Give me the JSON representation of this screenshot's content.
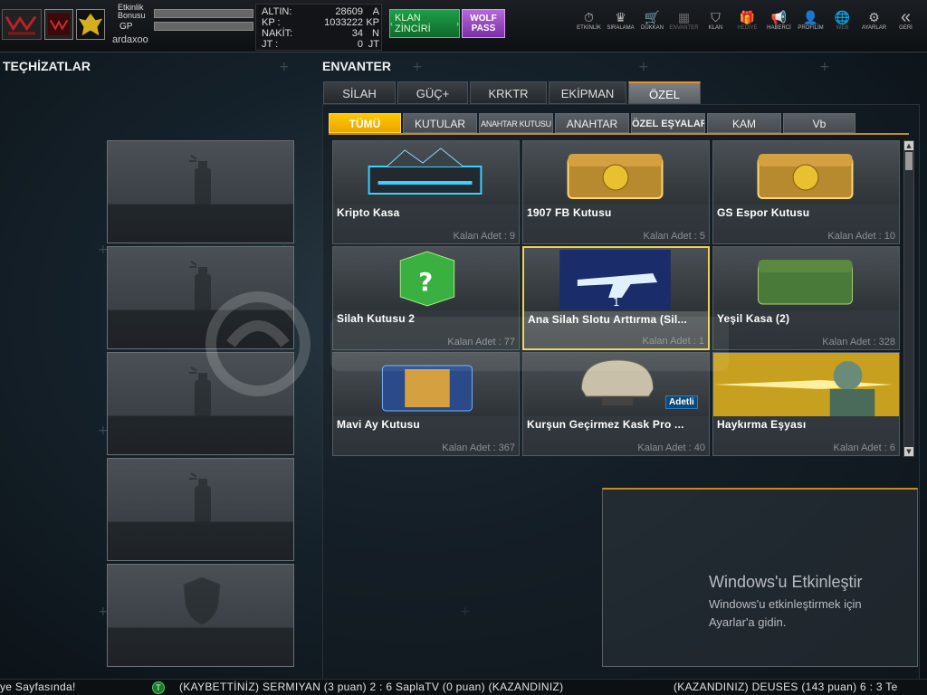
{
  "header": {
    "bars": {
      "etkinlik_label": "Etkinlik\nBonusu",
      "gp_label": "GP"
    },
    "username": "ardaxoo",
    "currency": [
      {
        "label": "ALTIN:",
        "value": "28609",
        "unit": "A"
      },
      {
        "label": "KP  :",
        "value": "1033222",
        "unit": "KP"
      },
      {
        "label": "NAKİT:",
        "value": "34",
        "unit": "N"
      },
      {
        "label": "JT  :",
        "value": "0",
        "unit": "JT"
      }
    ],
    "klan_button": "KLAN ZİNCİRİ",
    "wolf_button": "WOLF\nPASS",
    "nav": [
      {
        "icon": "stopwatch-icon",
        "glyph": "⏱",
        "label": "ETKİNLİK",
        "enabled": true
      },
      {
        "icon": "rank-icon",
        "glyph": "♛",
        "label": "SIRALAMA",
        "enabled": true
      },
      {
        "icon": "cart-icon",
        "glyph": "🛒",
        "label": "DÜKKAN",
        "enabled": true
      },
      {
        "icon": "inventory-icon",
        "glyph": "▦",
        "label": "ENVANTER",
        "enabled": false
      },
      {
        "icon": "clan-icon",
        "glyph": "⛉",
        "label": "KLAN",
        "enabled": true
      },
      {
        "icon": "gift-icon",
        "glyph": "🎁",
        "label": "HEDİYE",
        "enabled": false
      },
      {
        "icon": "megaphone-icon",
        "glyph": "📢",
        "label": "HABERCİ",
        "enabled": true
      },
      {
        "icon": "profile-icon",
        "glyph": "👤",
        "label": "PROFİLİM",
        "enabled": true
      },
      {
        "icon": "globe-icon",
        "glyph": "🌐",
        "label": "WEB",
        "enabled": false
      },
      {
        "icon": "gear-icon",
        "glyph": "⚙",
        "label": "AYARLAR",
        "enabled": true
      },
      {
        "icon": "back-icon",
        "glyph": "«",
        "label": "GERİ",
        "enabled": true
      }
    ]
  },
  "left_panel": {
    "title": "TEÇHİZATLAR",
    "slots": [
      {
        "type": "spray"
      },
      {
        "type": "spray"
      },
      {
        "type": "spray"
      },
      {
        "type": "spray"
      },
      {
        "type": "shield"
      }
    ]
  },
  "inventory": {
    "title": "ENVANTER",
    "tabs": [
      {
        "label": "SİLAH",
        "active": false
      },
      {
        "label": "GÜÇ+",
        "active": false
      },
      {
        "label": "KRKTR",
        "active": false
      },
      {
        "label": "EKİPMAN",
        "active": false
      },
      {
        "label": "ÖZEL",
        "active": true
      }
    ],
    "subtabs": [
      {
        "label": "TÜMÜ",
        "active": true
      },
      {
        "label": "KUTULAR",
        "active": false
      },
      {
        "label": "ANAHTAR KUTUSU",
        "active": false
      },
      {
        "label": "ANAHTAR",
        "active": false
      },
      {
        "label": "ÖZEL EŞYALAR",
        "active": false
      },
      {
        "label": "KAM",
        "active": false
      },
      {
        "label": "Vb",
        "active": false
      }
    ],
    "count_prefix": "Kalan Adet : ",
    "items": [
      {
        "name": "Kripto Kasa",
        "count": "9",
        "art": "crypto"
      },
      {
        "name": "1907 FB Kutusu",
        "count": "5",
        "art": "goldchest"
      },
      {
        "name": "GS Espor Kutusu",
        "count": "10",
        "art": "goldchest"
      },
      {
        "name": "Silah Kutusu 2",
        "count": "77",
        "art": "greencube"
      },
      {
        "name": "Ana Silah Slotu Arttırma (Sil...",
        "count": "1",
        "art": "gun",
        "selected": true
      },
      {
        "name": "Yeşil Kasa (2)",
        "count": "328",
        "art": "greenchest"
      },
      {
        "name": "Mavi Ay Kutusu",
        "count": "367",
        "art": "bluechest"
      },
      {
        "name": "Kurşun Geçirmez Kask Pro ...",
        "count": "40",
        "art": "helmet",
        "badge": "Adetli"
      },
      {
        "name": "Haykırma Eşyası",
        "count": "6",
        "art": "soldier"
      }
    ]
  },
  "windows_notice": {
    "title": "Windows'u Etkinleştir",
    "line1": "Windows'u etkinleştirmek için",
    "line2": "Ayarlar'a gidin."
  },
  "ticker": {
    "left": "ye Sayfasında!",
    "middle": "(KAYBETTİNİZ) SERMIYAN (3 puan) 2 : 6 SaplaTV (0 puan) (KAZANDINIZ)",
    "right": "(KAZANDINIZ) DEUSES (143 puan) 6 : 3 Te"
  },
  "colors": {
    "accent": "#ffc800",
    "tab_accent": "#e89020",
    "klan": "#1f9e4a",
    "wolf": "#9b4fc6"
  }
}
